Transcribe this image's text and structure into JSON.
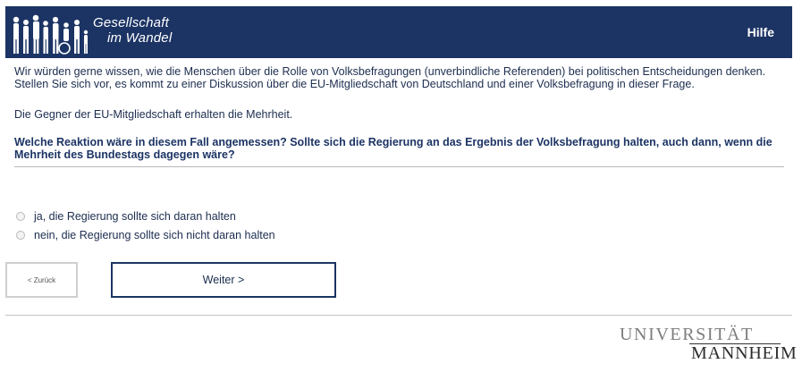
{
  "header": {
    "logo_line1": "Gesellschaft",
    "logo_line2": "im Wandel",
    "help_label": "Hilfe"
  },
  "survey": {
    "intro": "Wir würden gerne wissen, wie die Menschen über die Rolle von Volksbefragungen (unverbindliche Referenden) bei politischen Entscheidungen denken. Stellen Sie sich vor, es kommt zu einer Diskussion über die EU-Mitgliedschaft von Deutschland und einer Volksbefragung in dieser Frage.",
    "info": "Die Gegner der EU-Mitgliedschaft erhalten die Mehrheit.",
    "question": "Welche Reaktion wäre in diesem Fall angemessen? Sollte sich die Regierung an das Ergebnis der Volksbefragung halten, auch dann, wenn die Mehrheit des Bundestags dagegen wäre?",
    "options": [
      {
        "label": "ja, die Regierung sollte sich daran halten",
        "selected": false
      },
      {
        "label": "nein, die Regierung sollte sich nicht daran halten",
        "selected": false
      }
    ]
  },
  "navigation": {
    "back_label": "< Zurück",
    "next_label": "Weiter >"
  },
  "footer": {
    "university_line1": "UNIVERSITÄT",
    "university_line2": "MANNHEIM"
  },
  "colors": {
    "header_bg": "#1c3464",
    "text": "#1c2d4f"
  }
}
